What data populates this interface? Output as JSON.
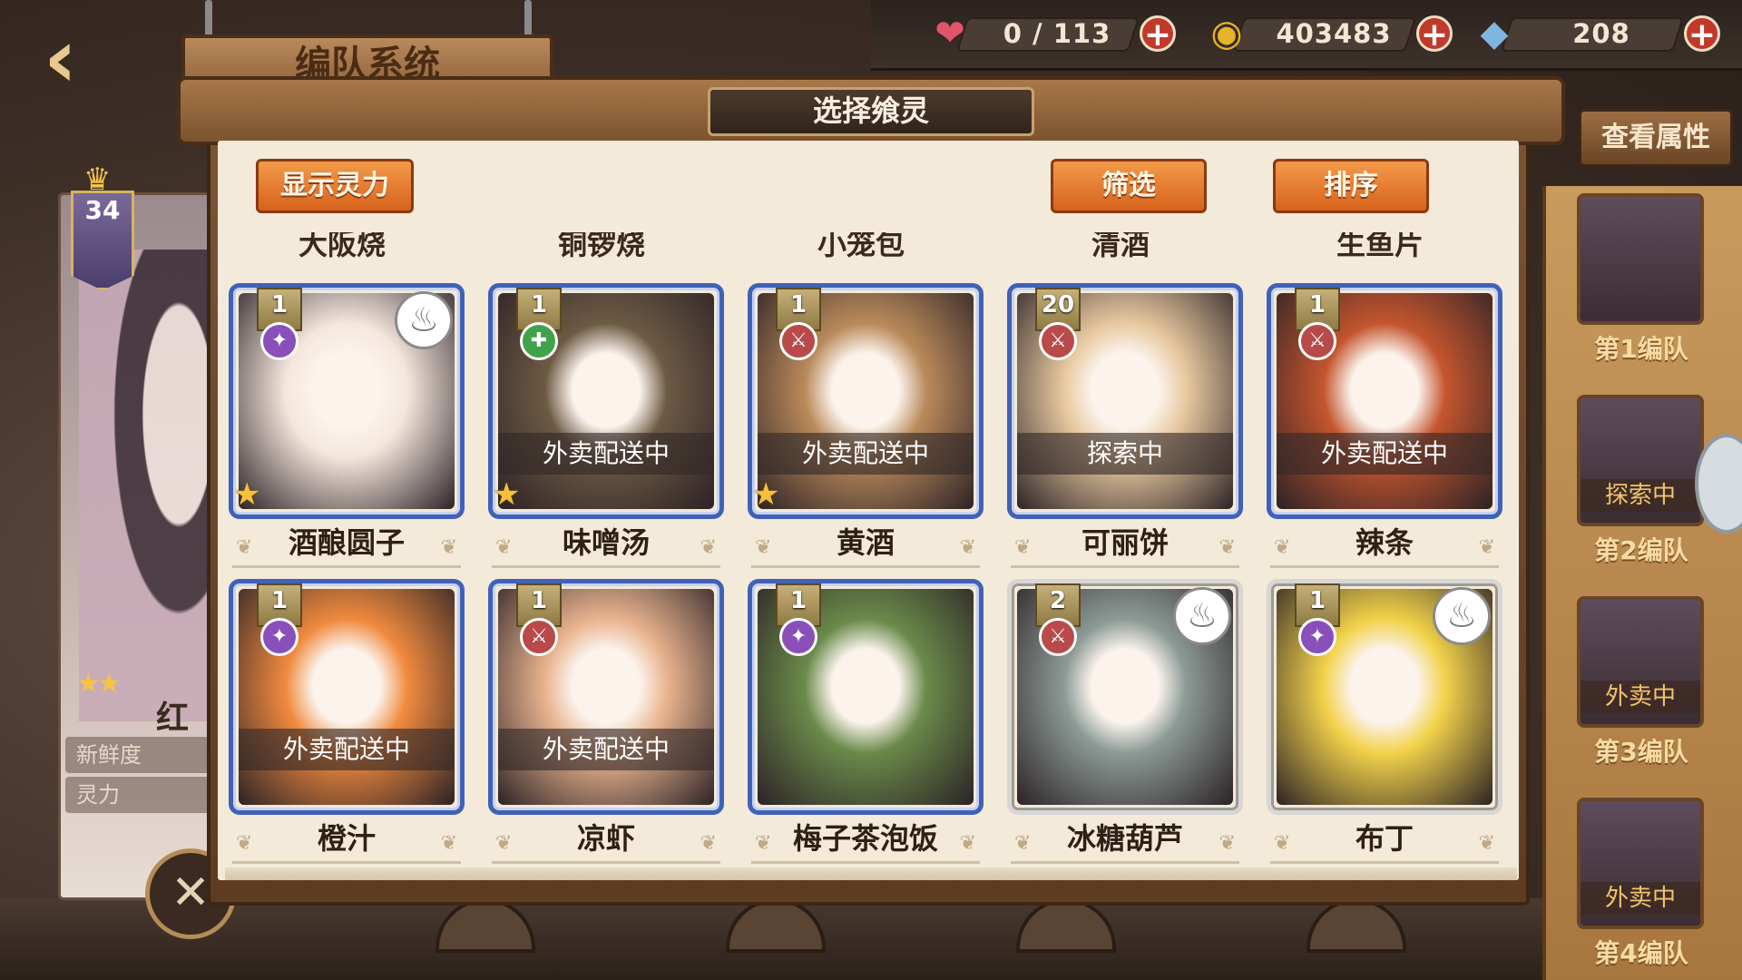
{
  "header": {
    "back_glyph": "‹",
    "title": "编队系统"
  },
  "resources": [
    {
      "name": "stamina",
      "icon": "heart-icon",
      "glyph": "❤",
      "color": "#e2546a",
      "value": "0 / 113",
      "plus": "+"
    },
    {
      "name": "gold",
      "icon": "coin-icon",
      "glyph": "◉",
      "color": "#e8b22a",
      "value": "403483",
      "plus": "+"
    },
    {
      "name": "crystal",
      "icon": "crystal-icon",
      "glyph": "◆",
      "color": "#7fb6e0",
      "value": "208",
      "plus": "+"
    }
  ],
  "left_character": {
    "level": "34",
    "name": "红",
    "stars": "★★",
    "freshness_label": "新鲜度",
    "spirit_label": "灵力",
    "action_glyph": "✕"
  },
  "modal": {
    "title": "选择飨灵",
    "show_power_btn": "显示灵力",
    "filter_btn": "筛选",
    "sort_btn": "排序"
  },
  "partial_row": [
    "大阪烧",
    "铜锣烧",
    "小笼包",
    "清酒",
    "生鱼片"
  ],
  "cards": [
    {
      "name": "酒酿圆子",
      "level": "1",
      "element": "purple",
      "chef": true,
      "status": "",
      "star": true,
      "frame": "blue",
      "tone": "#f4e6dc"
    },
    {
      "name": "味噌汤",
      "level": "1",
      "element": "green",
      "chef": false,
      "status": "外卖配送中",
      "star": true,
      "frame": "blue",
      "tone": "#6d5a44"
    },
    {
      "name": "黄酒",
      "level": "1",
      "element": "red",
      "chef": false,
      "status": "外卖配送中",
      "star": true,
      "frame": "blue",
      "tone": "#b98a5a"
    },
    {
      "name": "可丽饼",
      "level": "20",
      "element": "red",
      "chef": false,
      "status": "探索中",
      "star": false,
      "frame": "blue",
      "tone": "#e8c9a0"
    },
    {
      "name": "辣条",
      "level": "1",
      "element": "red",
      "chef": false,
      "status": "外卖配送中",
      "star": false,
      "frame": "blue",
      "tone": "#c4552e"
    },
    {
      "name": "橙汁",
      "level": "1",
      "element": "purple",
      "chef": false,
      "status": "外卖配送中",
      "star": false,
      "frame": "blue",
      "tone": "#f08a3e"
    },
    {
      "name": "凉虾",
      "level": "1",
      "element": "red",
      "chef": false,
      "status": "外卖配送中",
      "star": false,
      "frame": "blue",
      "tone": "#e9b48f"
    },
    {
      "name": "梅子茶泡饭",
      "level": "1",
      "element": "purple",
      "chef": false,
      "status": "",
      "star": false,
      "frame": "blue",
      "tone": "#6a8a4a"
    },
    {
      "name": "冰糖葫芦",
      "level": "2",
      "element": "red",
      "chef": true,
      "status": "",
      "star": false,
      "frame": "white",
      "tone": "#8c9a96"
    },
    {
      "name": "布丁",
      "level": "1",
      "element": "purple",
      "chef": true,
      "status": "",
      "star": false,
      "frame": "white",
      "tone": "#f2d24a"
    }
  ],
  "sidebar": {
    "view_attr_btn": "查看属性",
    "teams": [
      {
        "label": "第1编队",
        "status": ""
      },
      {
        "label": "第2编队",
        "status": "探索中"
      },
      {
        "label": "第3编队",
        "status": "外卖中"
      },
      {
        "label": "第4编队",
        "status": "外卖中"
      }
    ]
  }
}
